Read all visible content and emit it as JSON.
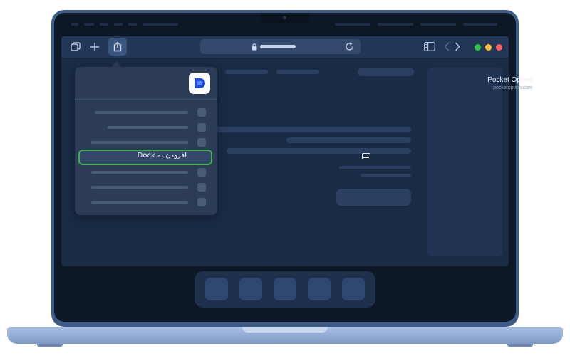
{
  "share_menu": {
    "app_name": "Pocket Option",
    "app_domain": "pocketoption.com",
    "highlighted_action": "افزودن به Dock",
    "highlight_color": "#3cb34a"
  },
  "browser": {
    "window_controls": [
      "close",
      "minimize",
      "zoom"
    ],
    "colors": {
      "close": "#ff5f57",
      "minimize": "#febc2e",
      "zoom": "#28c840"
    }
  },
  "icons": [
    "tabs-icon",
    "plus-icon",
    "share-icon",
    "lock-icon",
    "reload-icon",
    "sidebar-icon",
    "back-icon",
    "forward-icon",
    "dock-icon",
    "pocket-option-logo"
  ]
}
